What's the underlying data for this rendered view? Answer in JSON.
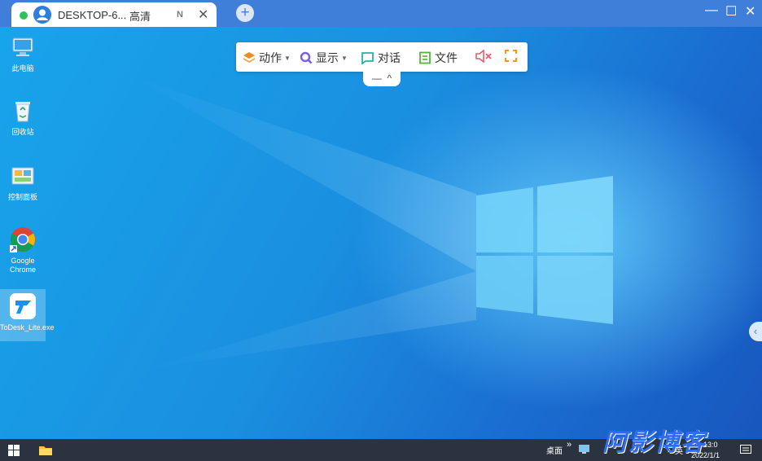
{
  "tab": {
    "title": "DESKTOP-6...",
    "quality": "高清",
    "badge": "N"
  },
  "window_controls": {
    "minimize": "—",
    "maximize": "☐",
    "close": "✕"
  },
  "desktop_icons": [
    {
      "label": "此电脑"
    },
    {
      "label": "回收站"
    },
    {
      "label": "控制面板"
    },
    {
      "label": "Google Chrome"
    },
    {
      "label": "ToDesk_Lite.exe"
    }
  ],
  "toolbar": {
    "action": "动作",
    "display": "显示",
    "chat": "对话",
    "file": "文件",
    "collapse_minus": "—",
    "collapse_up": "^"
  },
  "taskbar": {
    "desktop_label": "桌面",
    "expand": "»",
    "ime": "英",
    "time": "13:0",
    "date": "2022/1/1"
  },
  "watermark": "阿影博客",
  "colors": {
    "accent": "#3f7fd9",
    "online": "#2fc25b",
    "desktop": "#1a90e0"
  }
}
